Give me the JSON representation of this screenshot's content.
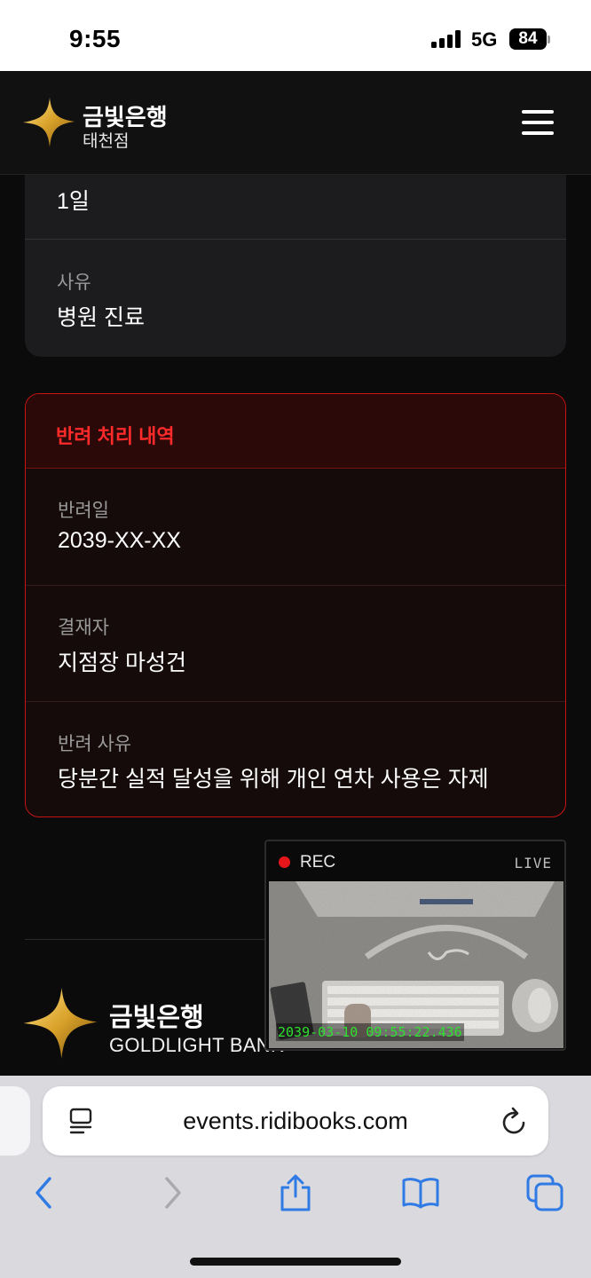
{
  "status_bar": {
    "time": "9:55",
    "network": "5G",
    "battery": "84"
  },
  "header": {
    "brand_name": "금빛은행",
    "branch": "태천점",
    "menu_icon": "hamburger-menu-icon"
  },
  "leave_card": {
    "duration_value": "1일",
    "reason_label": "사유",
    "reason_value": "병원 진료"
  },
  "reject_card": {
    "title": "반려 처리 내역",
    "fields": [
      {
        "label": "반려일",
        "value": "2039-XX-XX"
      },
      {
        "label": "결재자",
        "value": "지점장 마성건"
      },
      {
        "label": "반려 사유",
        "value": "당분간 실적 달성을 위해 개인 연차 사용은 자제"
      }
    ]
  },
  "footer": {
    "brand_name": "금빛은행",
    "brand_en": "GOLDLIGHT BANK"
  },
  "rec_overlay": {
    "rec_label": "REC",
    "live_label": "LIVE",
    "timestamp": "2039-03-10 09:55:22.436"
  },
  "safari": {
    "url": "events.ridibooks.com",
    "page_icon": "page-menu-icon",
    "reload_icon": "reload-icon",
    "toolbar_icons": [
      "back-icon",
      "forward-icon",
      "share-icon",
      "bookmarks-icon",
      "tabs-icon"
    ]
  },
  "colors": {
    "accent_red": "#ff2a2a",
    "gold": "#c9961e",
    "safari_link_blue": "#2f7ae5"
  }
}
